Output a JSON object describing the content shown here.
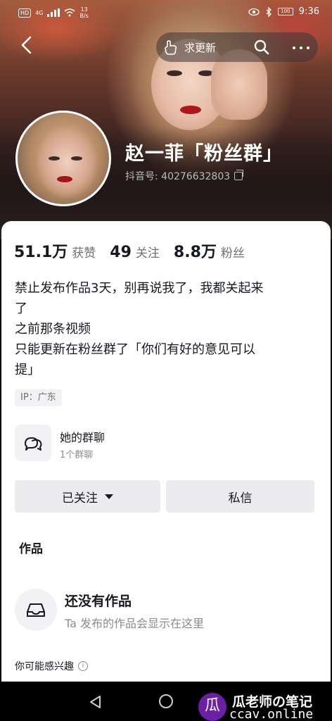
{
  "status_bar": {
    "network": "HD",
    "signal_label": "4G",
    "speed_value": "13",
    "speed_unit": "B/s",
    "battery": "100",
    "time": "9:36"
  },
  "nav": {
    "request_update_label": "求更新"
  },
  "profile": {
    "name": "赵一菲「粉丝群」",
    "douyin_id_label": "抖音号: 40276632803"
  },
  "stats": [
    {
      "value": "51.1万",
      "label": "获赞"
    },
    {
      "value": "49",
      "label": "关注"
    },
    {
      "value": "8.8万",
      "label": "粉丝"
    }
  ],
  "bio": {
    "line1": "禁止发布作品3天，别再说我了，我都关起来",
    "line2": "了",
    "line3": "之前那条视频",
    "line4": "只能更新在粉丝群了「你们有好的意见可以",
    "line5": "提」"
  },
  "ip_tag": "IP：广东",
  "group_chat": {
    "title": "她的群聊",
    "subtitle": "1个群聊"
  },
  "buttons": {
    "follow": "已关注",
    "message": "私信"
  },
  "works": {
    "title": "作品",
    "empty_title": "还没有作品",
    "empty_subtitle": "Ta 发布的作品会显示在这里"
  },
  "interest": {
    "label": "你可能感兴趣",
    "info_glyph": "i"
  },
  "watermark": {
    "logo_char": "瓜",
    "title": "瓜老师の笔记",
    "url": "ccav.online"
  },
  "colors": {
    "primary_text": "#161823",
    "secondary_text": "#8a8b91",
    "button_bg": "#ececef",
    "watermark_purple": "#6a1fa6"
  }
}
